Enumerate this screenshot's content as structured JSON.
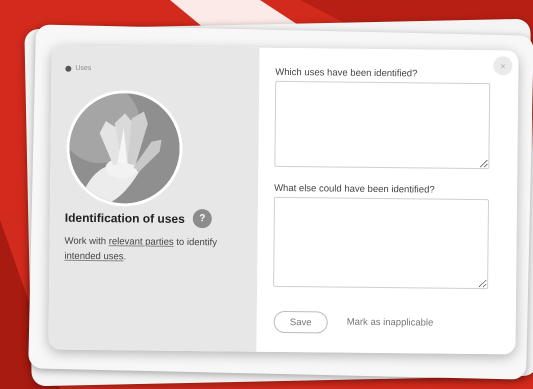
{
  "colors": {
    "backdrop_red": "#d22a1c",
    "panel_left": "#e7e7e7",
    "panel_right": "#ffffff",
    "help_badge": "#8c8c8c"
  },
  "sidebar": {
    "tag_label": "Uses",
    "tag_icon": "speech-bubble-icon",
    "image_alt": "hand holding tulips",
    "title": "Identification of uses",
    "help_icon_text": "?",
    "desc_before": "Work with ",
    "desc_link": "relevant parties",
    "desc_middle": " to identify ",
    "desc_link2": "intended uses",
    "desc_after": "."
  },
  "form": {
    "close_icon": "×",
    "question1": "Which uses have been identified?",
    "answer1": "",
    "question2": "What else could have been identified?",
    "answer2": "",
    "save_label": "Save",
    "mark_label": "Mark as inapplicable"
  }
}
